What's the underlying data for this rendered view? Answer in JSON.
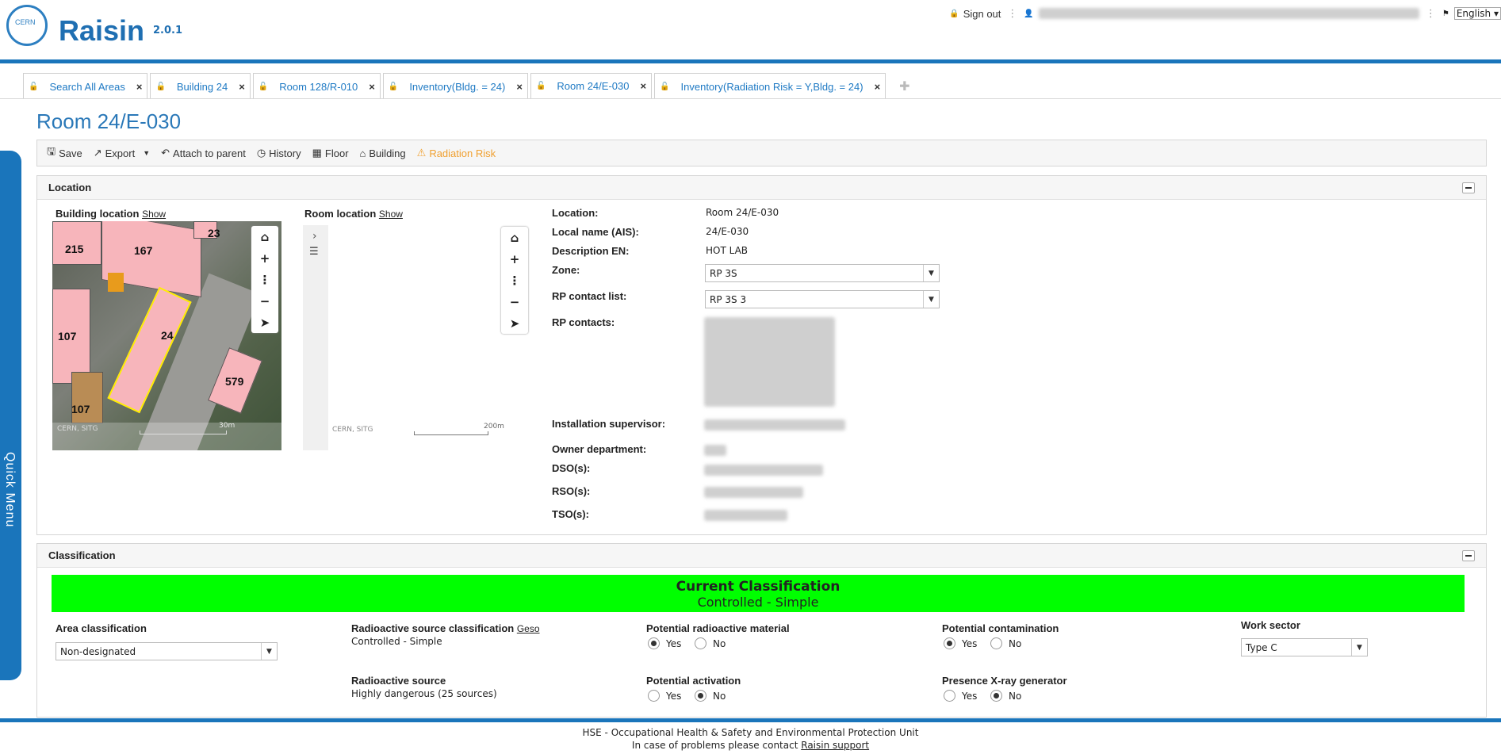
{
  "header": {
    "logo_text": "CERN",
    "app_name": "Raisin",
    "version": "2.0.1",
    "sign_out": "Sign out",
    "language": "English"
  },
  "tabs": [
    {
      "label": "Search All Areas"
    },
    {
      "label": "Building 24"
    },
    {
      "label": "Room 128/R-010"
    },
    {
      "label": "Inventory(Bldg. = 24)"
    },
    {
      "label": "Room 24/E-030"
    },
    {
      "label": "Inventory(Radiation Risk = Y,Bldg. = 24)"
    }
  ],
  "page_title": "Room 24/E-030",
  "toolbar": {
    "save": "Save",
    "export": "Export",
    "attach": "Attach to parent",
    "history": "History",
    "floor": "Floor",
    "building": "Building",
    "radiation_risk": "Radiation Risk"
  },
  "quick_menu": "Quick   Menu",
  "location": {
    "title": "Location",
    "building_location": "Building location",
    "room_location": "Room location",
    "show": "Show",
    "map1_buildings": [
      "215",
      "167",
      "23",
      "107",
      "24",
      "579",
      "107"
    ],
    "map1_attrib": "CERN, SITG",
    "map1_scale": "30m",
    "map2_attrib": "CERN, SITG",
    "map2_scale": "200m",
    "fields": {
      "location_label": "Location:",
      "location_value": "Room 24/E-030",
      "local_name_label": "Local name (AIS):",
      "local_name_value": "24/E-030",
      "description_label": "Description EN:",
      "description_value": "HOT LAB",
      "zone_label": "Zone:",
      "zone_value": "RP 3S",
      "rp_contact_list_label": "RP contact list:",
      "rp_contact_list_value": "RP 3S 3",
      "rp_contacts_label": "RP contacts:",
      "installation_supervisor_label": "Installation supervisor:",
      "owner_department_label": "Owner department:",
      "dso_label": "DSO(s):",
      "rso_label": "RSO(s):",
      "tso_label": "TSO(s):"
    }
  },
  "classification": {
    "title": "Classification",
    "current_title": "Current Classification",
    "current_value": "Controlled - Simple",
    "area_classification_label": "Area classification",
    "area_classification_value": "Non-designated",
    "radioactive_source_classification_label": "Radioactive source classification",
    "geso_link": "Geso",
    "radioactive_source_classification_value": "Controlled - Simple",
    "radioactive_source_label": "Radioactive source",
    "radioactive_source_value": "Highly dangerous (25 sources)",
    "potential_radioactive_material_label": "Potential radioactive material",
    "potential_activation_label": "Potential activation",
    "potential_contamination_label": "Potential contamination",
    "presence_xray_label": "Presence X-ray generator",
    "work_sector_label": "Work sector",
    "work_sector_value": "Type C",
    "yes": "Yes",
    "no": "No"
  },
  "footer": {
    "line1": "HSE - Occupational Health & Safety and Environmental Protection Unit",
    "line2_prefix": "In case of problems please contact",
    "support_link": "Raisin support"
  }
}
